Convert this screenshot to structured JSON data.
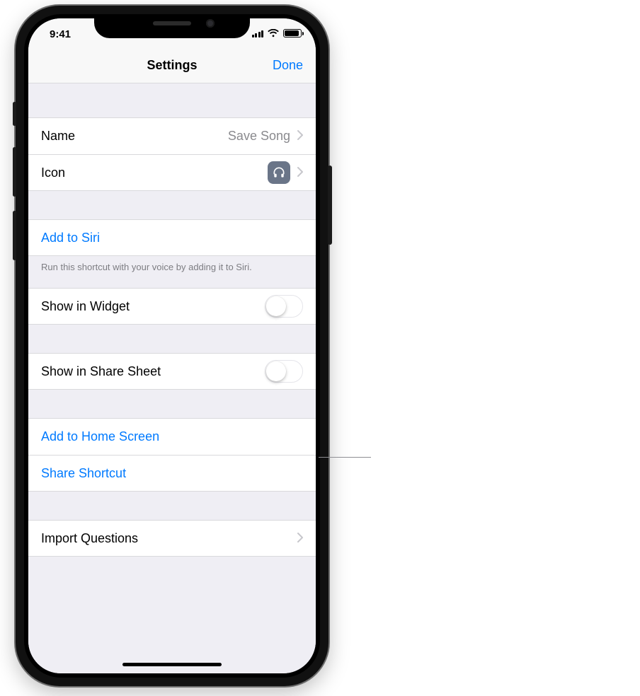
{
  "status": {
    "time": "9:41"
  },
  "nav": {
    "title": "Settings",
    "done": "Done"
  },
  "rows": {
    "name_label": "Name",
    "name_value": "Save Song",
    "icon_label": "Icon",
    "add_to_siri": "Add to Siri",
    "siri_footer": "Run this shortcut with your voice by adding it to Siri.",
    "show_widget": "Show in Widget",
    "show_share_sheet": "Show in Share Sheet",
    "add_home": "Add to Home Screen",
    "share_shortcut": "Share Shortcut",
    "import_questions": "Import Questions"
  },
  "toggles": {
    "show_widget": false,
    "show_share_sheet": false
  },
  "icons": {
    "shortcut_icon": "headphones-icon"
  },
  "colors": {
    "link": "#007aff",
    "icon_bg": "#6a7588"
  }
}
